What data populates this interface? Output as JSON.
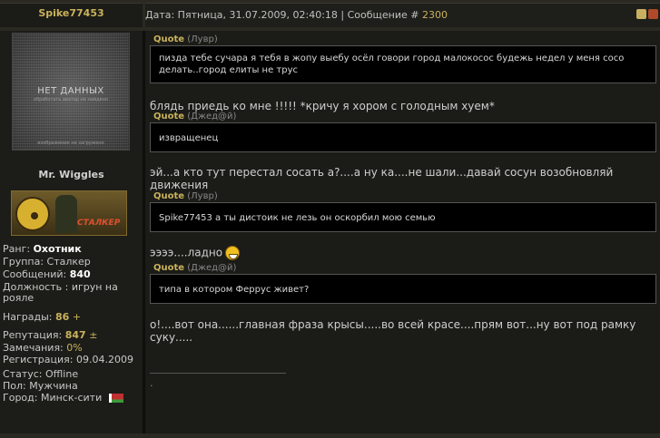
{
  "post": {
    "author": "Spike77453",
    "meta_prefix": "Дата: Пятница, 31.07.2009, 02:40:18 | Сообщение #",
    "number": "2300",
    "icons": [
      "thumb-up-icon",
      "thumb-down-icon"
    ]
  },
  "profile": {
    "avatar_title": "НЕТ ДАННЫХ",
    "avatar_sub": "обработать аватар не найдено",
    "avatar_foot": "изображение не загружено",
    "custom_title": "Mr. Wiggles",
    "rank_image_label": "СТАЛКЕР",
    "rank_label": "Ранг:",
    "rank_value": "Охотник",
    "group_label": "Группа:",
    "group_value": "Сталкер",
    "messages_label": "Сообщений:",
    "messages_value": "840",
    "position_label": "Должность :",
    "position_value_1": "игрун на",
    "position_value_2": "рояле",
    "awards_label": "Награды:",
    "awards_value": "86",
    "awards_plus": "+",
    "reputation_label": "Репутация:",
    "reputation_value": "847",
    "reputation_pm": "±",
    "warnings_label": "Замечания:",
    "warnings_value": "0%",
    "registered_label": "Регистрация:",
    "registered_value": "09.04.2009",
    "status_label": "Статус:",
    "status_value": "Offline",
    "gender_label": "Пол:",
    "gender_value": "Мужчина",
    "city_label": "Город:",
    "city_value": "Минск-сити"
  },
  "content": {
    "quote_word": "Quote",
    "q1_author": "(Лувр)",
    "q1_text": "пизда тебе сучара я тебя в жопу выебу осёл говори город малокосос будежь недел у меня сосо делать..город елиты не трус",
    "t1": "блядь приедь ко мне !!!!! *кричу я хором с голодным хуем*",
    "q2_author": "(Джед@й)",
    "q2_text": "извращенец",
    "t2": "эй...а кто тут перестал сосать а?....а ну ка....не шали...давай сосун возобновляй движения",
    "q3_author": "(Лувр)",
    "q3_text": "Spike77453 а ты дистоик не лезь он оскорбил мою семью",
    "t3": "ээээ....ладно",
    "q4_author": "(Джед@й)",
    "q4_text": "типа в котором Феррус живет?",
    "t4": "о!....вот она......главная фраза крысы.....во всей красе....прям вот...ну вот под рамку суку.....",
    "sig_dot": "."
  }
}
